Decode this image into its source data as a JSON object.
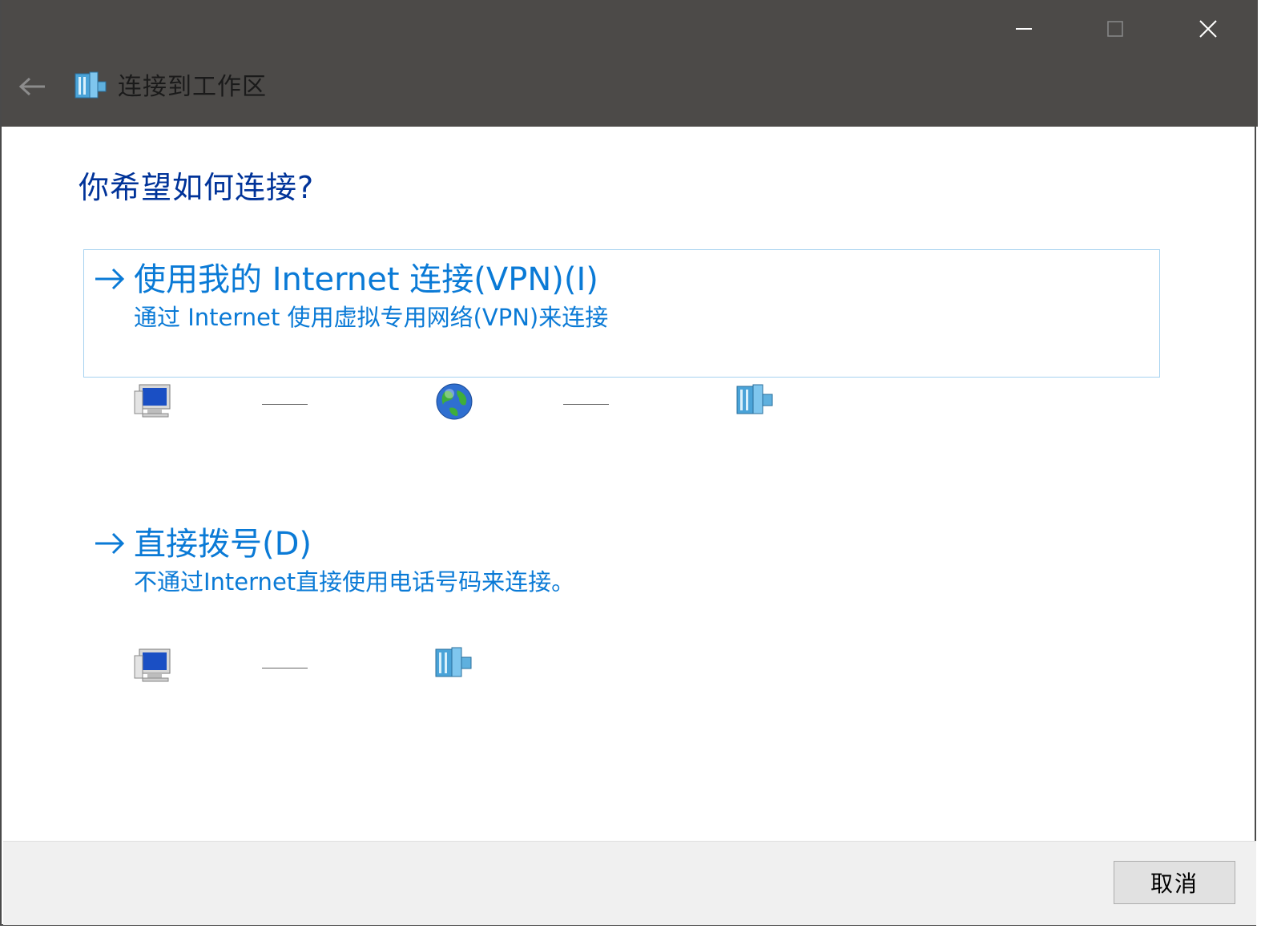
{
  "window": {
    "title": "连接到工作区",
    "controls": {
      "minimize": "minimize-icon",
      "maximize": "maximize-icon",
      "close": "close-icon"
    },
    "back_icon": "back-arrow-icon"
  },
  "main": {
    "heading": "你希望如何连接?",
    "options": [
      {
        "title": "使用我的 Internet 连接(VPN)(I)",
        "description": "通过 Internet 使用虚拟专用网络(VPN)来连接",
        "diagram": [
          "computer-icon",
          "globe-icon",
          "workplace-icon"
        ]
      },
      {
        "title": "直接拨号(D)",
        "description": "不通过Internet直接使用电话号码来连接。",
        "diagram": [
          "computer-icon",
          "workplace-icon"
        ]
      }
    ]
  },
  "footer": {
    "cancel_label": "取消"
  },
  "colors": {
    "titlebar": "#4c4a48",
    "heading": "#003399",
    "link": "#0a7ad6",
    "selection_border": "#a6d2f0",
    "footer": "#f0f0f0"
  }
}
